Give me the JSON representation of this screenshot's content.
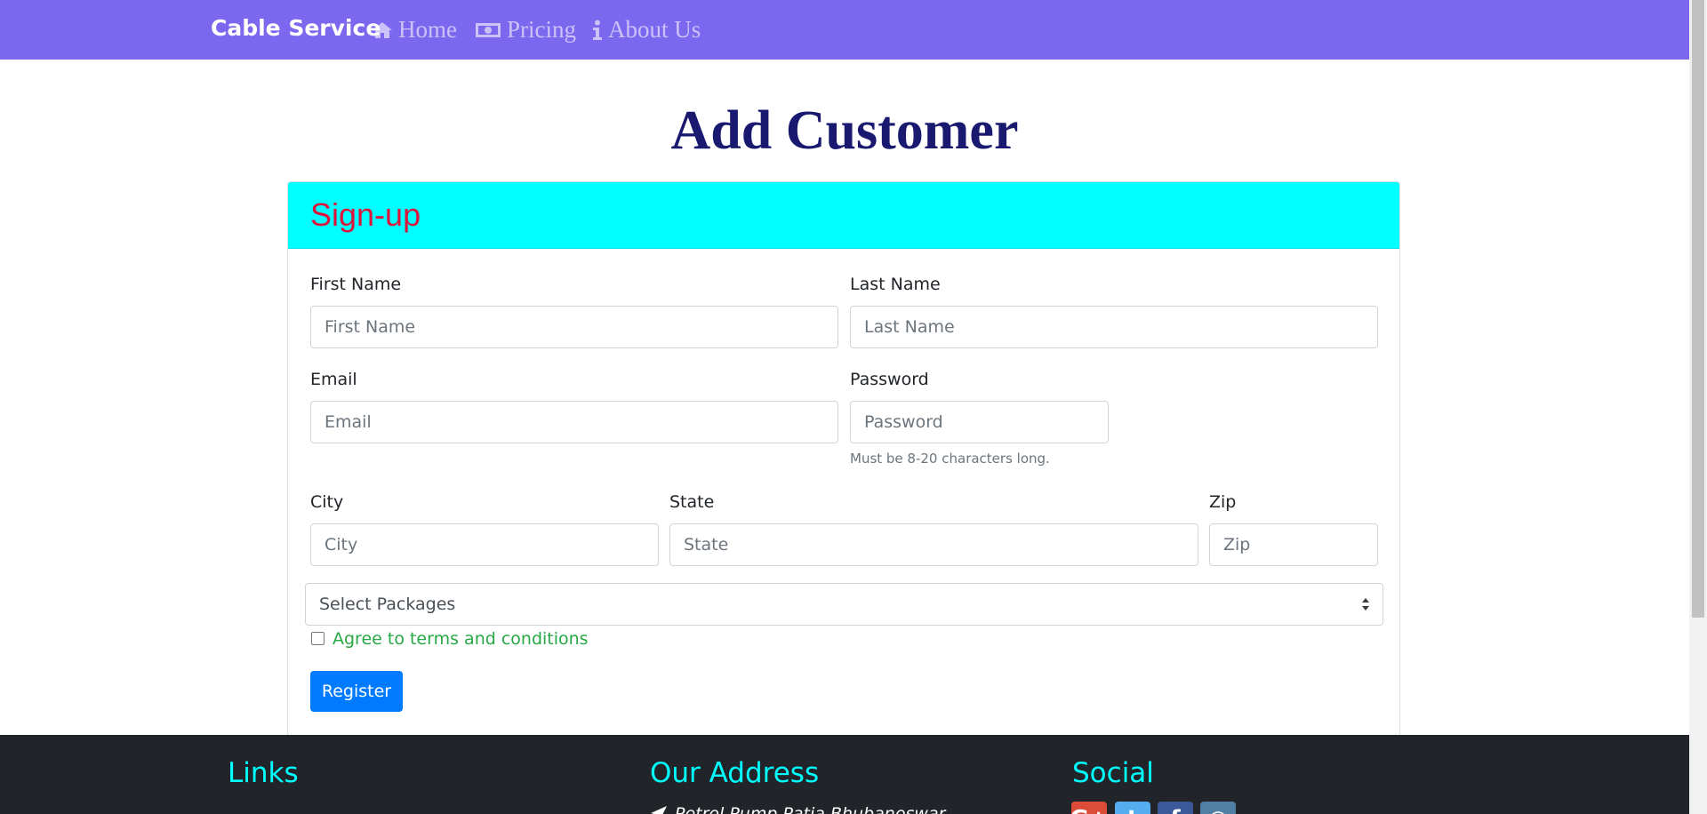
{
  "navbar": {
    "brand": "Cable Service",
    "items": [
      {
        "label": "Home",
        "icon": "home-icon"
      },
      {
        "label": "Pricing",
        "icon": "money-icon"
      },
      {
        "label": "About Us",
        "icon": "info-icon"
      }
    ]
  },
  "page_title": "Add Customer",
  "form": {
    "header": "Sign-up",
    "first_name": {
      "label": "First Name",
      "placeholder": "First Name",
      "value": ""
    },
    "last_name": {
      "label": "Last Name",
      "placeholder": "Last Name",
      "value": ""
    },
    "email": {
      "label": "Email",
      "placeholder": "Email",
      "value": ""
    },
    "password": {
      "label": "Password",
      "placeholder": "Password",
      "value": "",
      "help": "Must be 8-20 characters long."
    },
    "city": {
      "label": "City",
      "placeholder": "City",
      "value": ""
    },
    "state": {
      "label": "State",
      "placeholder": "State",
      "value": ""
    },
    "zip": {
      "label": "Zip",
      "placeholder": "Zip",
      "value": ""
    },
    "packages": {
      "selected": "Select Packages"
    },
    "terms": {
      "label": "Agree to terms and conditions",
      "checked": false
    },
    "register_label": "Register"
  },
  "footer": {
    "links_heading": "Links",
    "address_heading": "Our Address",
    "social_heading": "Social",
    "address_line": "Petrol Pump,Patia,Bhubaneswar",
    "social": [
      {
        "name": "google-plus-icon",
        "glyph": "G+",
        "color": "#dd4b39"
      },
      {
        "name": "twitter-icon",
        "glyph": "t",
        "color": "#55acee"
      },
      {
        "name": "facebook-icon",
        "glyph": "f",
        "color": "#3b5998"
      },
      {
        "name": "instagram-icon",
        "glyph": "◎",
        "color": "#517fa4"
      }
    ]
  },
  "colors": {
    "navbar": "#7b68ee",
    "title": "#191970",
    "card_header": "#00ffff",
    "card_header_text": "#dc143c",
    "terms_text": "#28a745",
    "primary_button": "#007bff",
    "footer_bg": "#212529",
    "footer_heading": "#00ffff"
  }
}
